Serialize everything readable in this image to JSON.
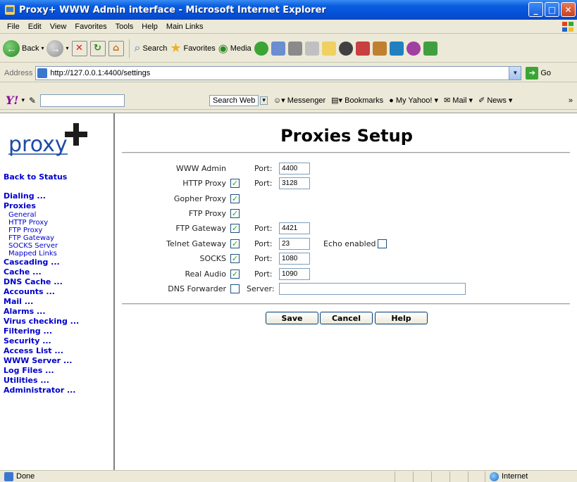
{
  "window": {
    "title": "Proxy+ WWW Admin interface - Microsoft Internet Explorer"
  },
  "menu": [
    "File",
    "Edit",
    "View",
    "Favorites",
    "Tools",
    "Help",
    "Main Links"
  ],
  "toolbar": {
    "back_label": "Back",
    "search_label": "Search",
    "favorites_label": "Favorites",
    "media_label": "Media"
  },
  "address": {
    "label": "Address",
    "url": "http://127.0.0.1:4400/settings",
    "go_label": "Go"
  },
  "yahoo": {
    "logo": "Y!",
    "search_label": "Search Web",
    "messenger": "Messenger",
    "bookmarks": "Bookmarks",
    "my_yahoo": "My Yahoo!",
    "mail": "Mail",
    "news": "News"
  },
  "sidebar": {
    "logo_text": "proxy",
    "links": {
      "back_to_status": "Back to Status",
      "dialing": "Dialing ...",
      "proxies": "Proxies",
      "general": "General",
      "http_proxy": "HTTP Proxy",
      "ftp_proxy": "FTP Proxy",
      "ftp_gateway": "FTP Gateway",
      "socks_server": "SOCKS Server",
      "mapped_links": "Mapped Links",
      "cascading": "Cascading ...",
      "cache": "Cache ...",
      "dns_cache": "DNS Cache ...",
      "accounts": "Accounts ...",
      "mail": "Mail ...",
      "alarms": "Alarms ...",
      "virus_checking": "Virus checking ...",
      "filtering": "Filtering ...",
      "security": "Security ...",
      "access_list": "Access List ...",
      "www_server": "WWW Server ...",
      "log_files": "Log Files ...",
      "utilities": "Utilities ...",
      "administrator": "Administrator ..."
    }
  },
  "page": {
    "title": "Proxies Setup",
    "port_label": "Port:",
    "server_label": "Server:",
    "echo_label": "Echo enabled",
    "rows": {
      "www_admin": {
        "label": "WWW Admin",
        "port": "4400"
      },
      "http_proxy": {
        "label": "HTTP Proxy",
        "checked": true,
        "port": "3128"
      },
      "gopher_proxy": {
        "label": "Gopher Proxy",
        "checked": true
      },
      "ftp_proxy": {
        "label": "FTP Proxy",
        "checked": true
      },
      "ftp_gateway": {
        "label": "FTP Gateway",
        "checked": true,
        "port": "4421"
      },
      "telnet_gateway": {
        "label": "Telnet Gateway",
        "checked": true,
        "port": "23",
        "echo_enabled": false
      },
      "socks": {
        "label": "SOCKS",
        "checked": true,
        "port": "1080"
      },
      "real_audio": {
        "label": "Real Audio",
        "checked": true,
        "port": "1090"
      },
      "dns_forwarder": {
        "label": "DNS Forwarder",
        "checked": false,
        "server": ""
      }
    },
    "buttons": {
      "save": "Save",
      "cancel": "Cancel",
      "help": "Help"
    }
  },
  "status": {
    "text": "Done",
    "zone": "Internet"
  }
}
